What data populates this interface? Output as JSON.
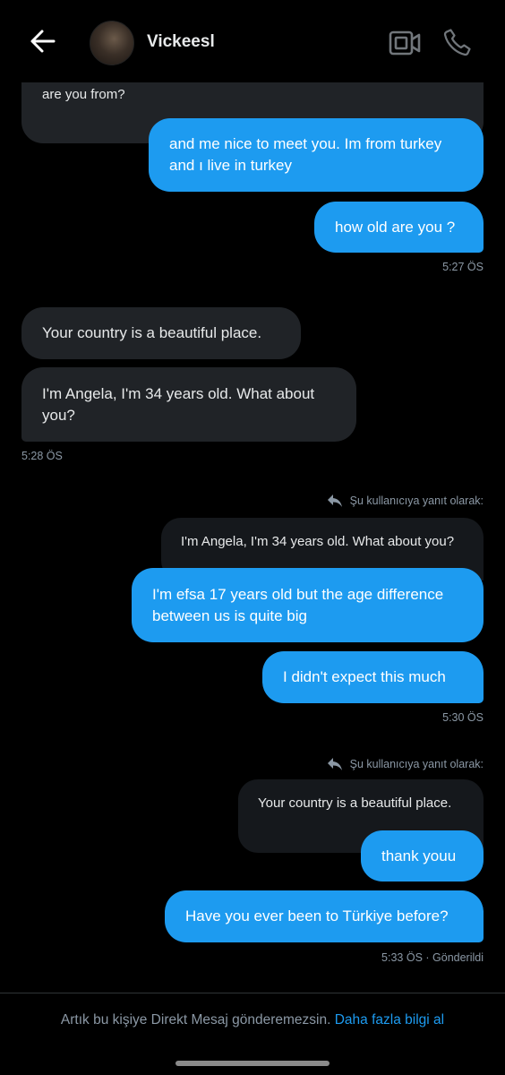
{
  "header": {
    "contact_name": "Vickeesl"
  },
  "messages": {
    "top_partial": "Nice to meet you. I'm from Germany but now I live in the USA. Where are you from?",
    "m1": "and me nice to meet you. Im from turkey and ı live in turkey",
    "m2": "how old are you ?",
    "t1": "5:27 ÖS",
    "m3": "Your country is a beautiful place.",
    "m4": "I'm Angela, I'm 34 years old. What about you?",
    "t2": "5:28 ÖS",
    "reply_note1": "Şu kullanıcıya yanıt olarak:",
    "quote1": "I'm Angela, I'm 34 years old. What about you?",
    "m5": "I'm efsa 17 years old but the age difference between us is quite big",
    "m6": "I didn't expect this much",
    "t3": "5:30 ÖS",
    "reply_note2": "Şu kullanıcıya yanıt olarak:",
    "quote2": "Your country is a beautiful place.",
    "m7": "thank youu",
    "m8": "Have you ever been to Türkiye before?",
    "t4": "5:33 ÖS · Gönderildi"
  },
  "footer": {
    "notice": "Artık bu kişiye Direkt Mesaj gönderemezsin.",
    "link": "Daha fazla bilgi al"
  },
  "colors": {
    "accent": "#1d9bf0",
    "incoming_bubble": "#202327",
    "background": "#000000"
  },
  "icons": [
    "back-arrow-icon",
    "video-call-icon",
    "phone-icon",
    "reply-arrow-icon"
  ]
}
